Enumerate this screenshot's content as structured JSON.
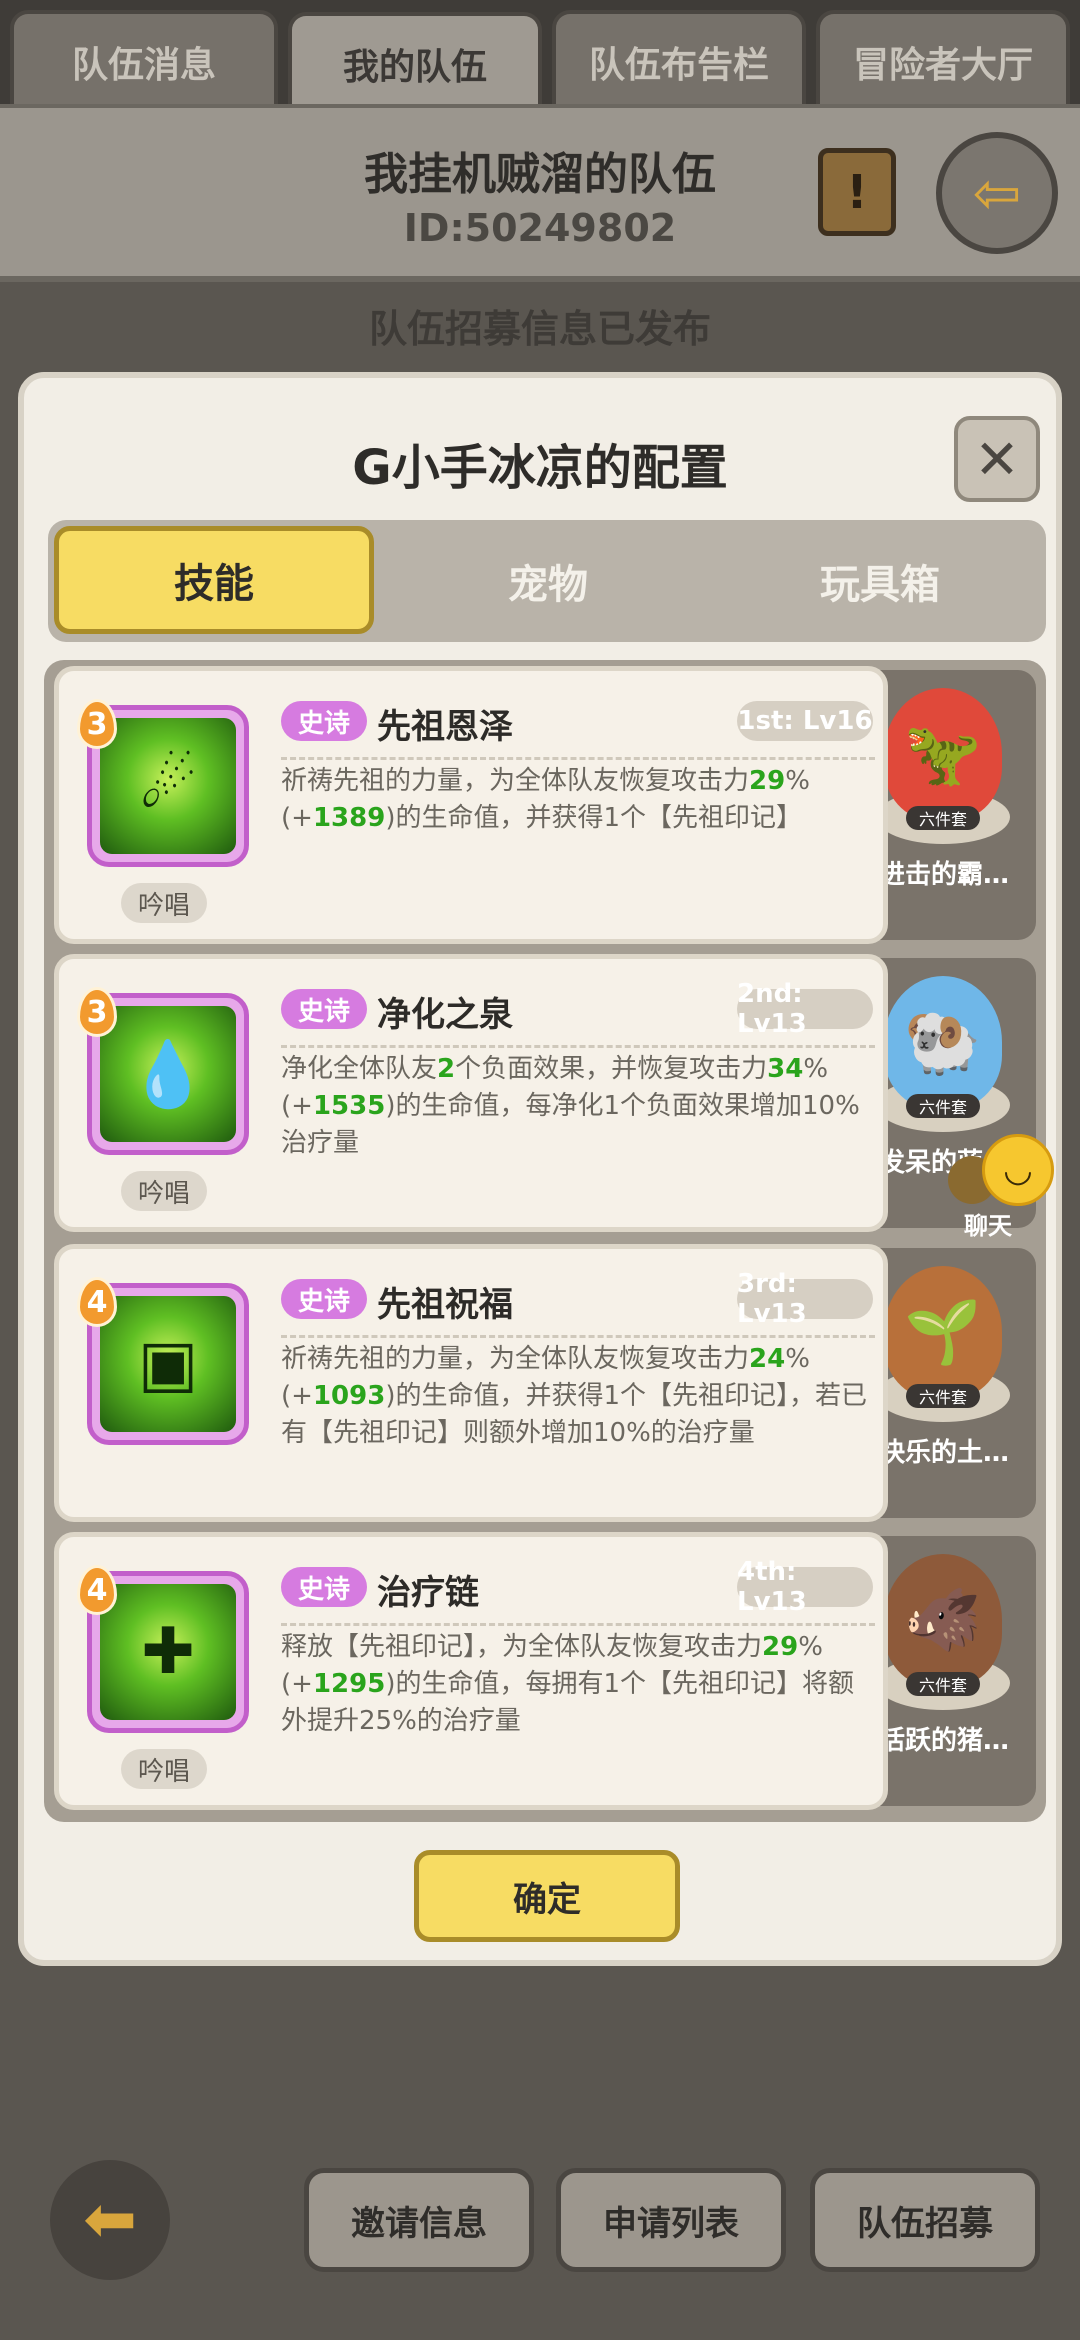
{
  "top_tabs": [
    "队伍消息",
    "我的队伍",
    "队伍布告栏",
    "冒险者大厅"
  ],
  "team": {
    "name": "我挂机贼溜的队伍",
    "id": "ID:50249802"
  },
  "recruit_status": "队伍招募信息已发布",
  "modal": {
    "title": "G小手冰凉的配置",
    "tabs": [
      "技能",
      "宠物",
      "玩具箱"
    ],
    "confirm_label": "确定",
    "skills": [
      {
        "level": "3",
        "rarity": "史诗",
        "name": "先祖恩泽",
        "slot": "1st: Lv16",
        "chant": "吟唱",
        "desc_parts": [
          "祈祷先祖的力量，为全体队友恢复攻击力",
          "29",
          "%(+",
          "1389",
          ")的生命值，并获得1个【先祖印记】"
        ]
      },
      {
        "level": "3",
        "rarity": "史诗",
        "name": "净化之泉",
        "slot": "2nd: Lv13",
        "chant": "吟唱",
        "desc_parts": [
          "净化全体队友",
          "2",
          "个负面效果，并恢复攻击力",
          "34",
          "%(+",
          "1535",
          ")的生命值，每净化1个负面效果增加10%治疗量"
        ]
      },
      {
        "level": "4",
        "rarity": "史诗",
        "name": "先祖祝福",
        "slot": "3rd: Lv13",
        "chant": "",
        "desc_parts": [
          "祈祷先祖的力量，为全体队友恢复攻击力",
          "24",
          "%(+",
          "1093",
          ")的生命值，并获得1个【先祖印记】，若已有【先祖印记】则额外增加10%的治疗量"
        ]
      },
      {
        "level": "4",
        "rarity": "史诗",
        "name": "治疗链",
        "slot": "4th: Lv13",
        "chant": "吟唱",
        "desc_parts": [
          "释放【先祖印记】，为全体队友恢复攻击力",
          "29",
          "%(+",
          "1295",
          ")的生命值，每拥有1个【先祖印记】将额外提升25%的治疗量"
        ]
      }
    ],
    "pets": [
      {
        "name": "进击的霸…",
        "set": "六件套",
        "icon": "dinosaur-pet-icon",
        "color": "#e0493a"
      },
      {
        "name": "发呆的蓝…",
        "set": "六件套",
        "icon": "blue-ram-pet-icon",
        "color": "#6fb7e8"
      },
      {
        "name": "快乐的土…",
        "set": "六件套",
        "icon": "mole-pet-icon",
        "color": "#b8703a"
      },
      {
        "name": "活跃的猪…",
        "set": "六件套",
        "icon": "boar-pet-icon",
        "color": "#8e5a3a"
      }
    ]
  },
  "chat": {
    "label": "聊天"
  },
  "bottom_buttons": [
    "邀请信息",
    "申请列表",
    "队伍招募"
  ],
  "colors": {
    "highlight_green": "#2aa41c",
    "accent_yellow": "#f7dc63",
    "epic_purple": "#d67be0"
  }
}
